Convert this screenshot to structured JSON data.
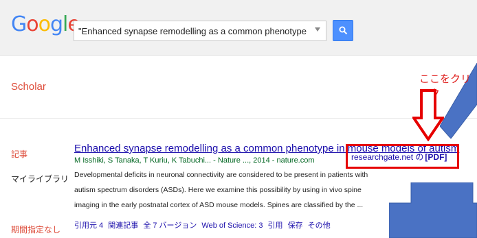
{
  "header": {
    "logo_letters": [
      {
        "char": "G",
        "color": "#4285f4"
      },
      {
        "char": "o",
        "color": "#ea4335"
      },
      {
        "char": "o",
        "color": "#fbbc05"
      },
      {
        "char": "g",
        "color": "#4285f4"
      },
      {
        "char": "l",
        "color": "#34a853"
      },
      {
        "char": "e",
        "color": "#ea4335"
      }
    ],
    "search_value": "\"Enhanced synapse remodelling as a common phenotype in mouse models",
    "search_button_icon": "search-icon"
  },
  "sidebar": {
    "scholar_label": "Scholar",
    "articles_label": "記事",
    "my_library_label": "マイライブラリ",
    "date_range_label": "期間指定なし"
  },
  "result": {
    "title": "Enhanced synapse remodelling as a common phenotype in mouse models of autism",
    "authors": "M Isshiki, S Tanaka, T Kuriu, K Tabuchi... - Nature ..., 2014 - nature.com",
    "snippet_lines": [
      "Developmental deficits in neuronal connectivity are considered to be present in patients with",
      "autism spectrum disorders (ASDs). Here we examine this possibility by using in vivo spine",
      "imaging in the early postnatal cortex of ASD mouse models. Spines are classified by the ..."
    ],
    "links": [
      "引用元 4",
      "関連記事",
      "全 7 バージョン",
      "Web of Science: 3",
      "引用",
      "保存",
      "その他"
    ],
    "pdf_source": "researchgate.net の",
    "pdf_tag": "[PDF]"
  },
  "annotation": {
    "click_here": "ここをクリック",
    "highlight_color": "#e60000",
    "arrow_color": "#4a72c4"
  }
}
